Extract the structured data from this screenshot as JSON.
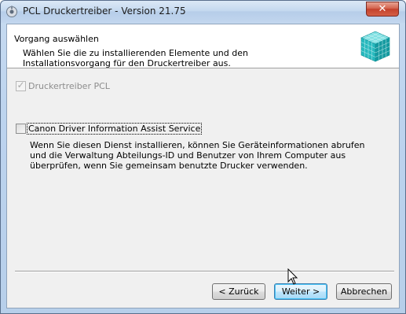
{
  "window": {
    "title": "PCL Druckertreiber - Version 21.75",
    "close_label": "✕"
  },
  "header": {
    "title": "Vorgang auswählen",
    "description": "Wählen Sie die zu installierenden Elemente und den Installationsvorgang für den Druckertreiber aus."
  },
  "options": [
    {
      "label": "Druckertreiber PCL",
      "checked": true,
      "enabled": false
    },
    {
      "label": "Canon Driver Information Assist Service",
      "checked": false,
      "enabled": true
    }
  ],
  "service_description": "Wenn Sie diesen Dienst installieren, können Sie Geräteinformationen abrufen und die Verwaltung Abteilungs-ID und Benutzer von Ihrem Computer aus überprüfen, wenn Sie gemeinsam benutzte Drucker verwenden.",
  "buttons": {
    "back": "< Zurück",
    "next": "Weiter >",
    "cancel": "Abbrechen"
  },
  "colors": {
    "accent": "#48c2f4",
    "icon_teal": "#1fb3b7"
  }
}
